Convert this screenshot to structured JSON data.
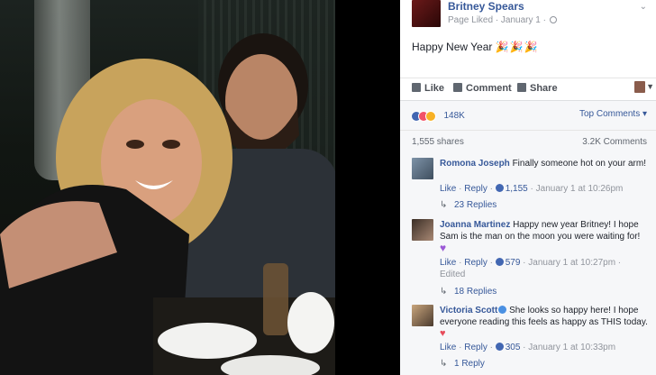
{
  "post": {
    "page_name": "Britney Spears",
    "meta": "Page Liked · January 1 ·",
    "text": "Happy New Year",
    "emoji": "🎉🎉🎉"
  },
  "actions": {
    "like": "Like",
    "comment": "Comment",
    "share": "Share"
  },
  "stats": {
    "reaction_count": "148K",
    "sort_label": "Top Comments ▾",
    "shares": "1,555 shares",
    "comments": "3.2K Comments"
  },
  "comments": [
    {
      "name": "Romona Joseph",
      "text": "Finally someone hot on your arm!",
      "like": "Like",
      "reply": "Reply",
      "likes": "1,155",
      "time": "January 1 at 10:26pm",
      "replies": "23 Replies"
    },
    {
      "name": "Joanna Martinez",
      "text": "Happy new year Britney! I hope Sam is the man on the moon you were waiting for!",
      "like": "Like",
      "reply": "Reply",
      "likes": "579",
      "time": "January 1 at 10:27pm",
      "edited": "Edited",
      "replies": "18 Replies"
    },
    {
      "name": "Victoria Scott",
      "text": "She looks so happy here! I hope everyone reading this feels as happy as THIS today.",
      "like": "Like",
      "reply": "Reply",
      "likes": "305",
      "time": "January 1 at 10:33pm",
      "replies": "1 Reply"
    }
  ],
  "colors": {
    "link": "#365899",
    "text": "#1d2129",
    "muted": "#90949c",
    "panel_bg": "#f6f7f9"
  }
}
